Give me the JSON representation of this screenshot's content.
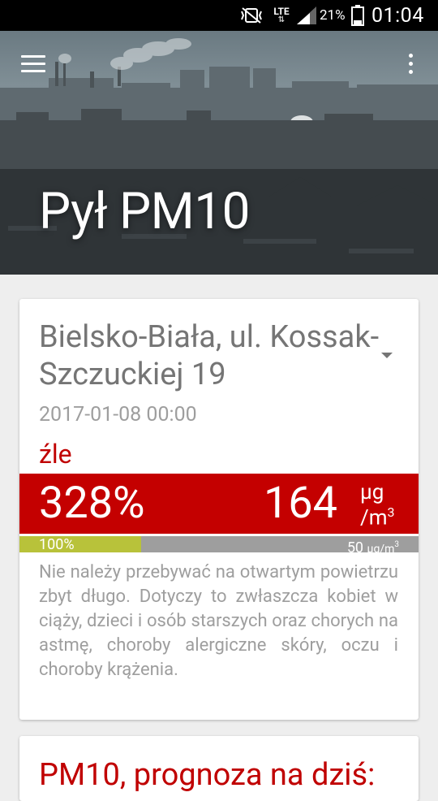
{
  "status_bar": {
    "network": "LTE",
    "battery_percent": "21%",
    "time": "01:04"
  },
  "header": {
    "title": "Pył PM10"
  },
  "station_card": {
    "station_name": "Bielsko-Biała, ul. Kossak-Szczuckiej 19",
    "measurement_time": "2017-01-08 00:00",
    "quality_label": "źle",
    "quality_color": "#c40000",
    "percent_of_norm": "328%",
    "concentration": "164",
    "unit_top": "µg",
    "unit_bottom": "/m",
    "unit_exp": "3",
    "limit_bar": {
      "fill_fraction": 0.305,
      "fill_label": "100%",
      "norm_value": "50",
      "norm_unit": "µg/m",
      "norm_exp": "3",
      "fill_color": "#b8c23a"
    },
    "description": "Nie należy przebywać na otwartym powietrzu zbyt długo. Dotyczy to zwłaszcza kobiet w ciąży, dzieci i osób starszych oraz chorych na astmę, choroby alergiczne skóry, oczu i choroby krążenia."
  },
  "forecast_card": {
    "title": "PM10, prognoza na dziś:"
  }
}
